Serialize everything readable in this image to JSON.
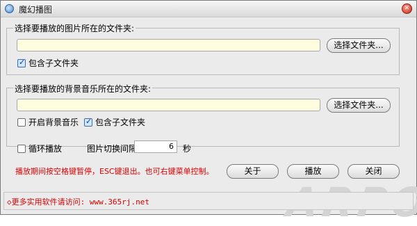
{
  "window": {
    "title": "魔幻播图",
    "app_icon": "app-icon",
    "close_icon": "close-icon"
  },
  "picture_group": {
    "label": "选择要播放的图片所在的文件夹:",
    "path_value": "",
    "browse_label": "选择文件夹...",
    "include_subfolders_label": "包含子文件夹",
    "include_subfolders_checked": true
  },
  "music_group": {
    "label": "选择要播放的背景音乐所在的文件夹:",
    "path_value": "",
    "browse_label": "选择文件夹...",
    "enable_music_label": "开启背景音乐",
    "enable_music_checked": false,
    "include_subfolders_label": "包含子文件夹",
    "include_subfolders_checked": true
  },
  "options": {
    "loop_label": "循环播放",
    "loop_checked": false,
    "interval_label": "图片切换间隔:",
    "interval_value": "6",
    "interval_unit": "秒"
  },
  "notice": "播放期间按空格键暂停，ESC键退出。也可右键菜单控制。",
  "buttons": {
    "about": "关于",
    "play": "播放",
    "close": "关闭"
  },
  "footer": {
    "text": "◇更多实用软件请访问: www.365rj.net"
  },
  "watermark": "ARPON",
  "colors": {
    "notice": "#e00000",
    "input_bg": "#fffce0",
    "close_button": "#c2291b"
  }
}
